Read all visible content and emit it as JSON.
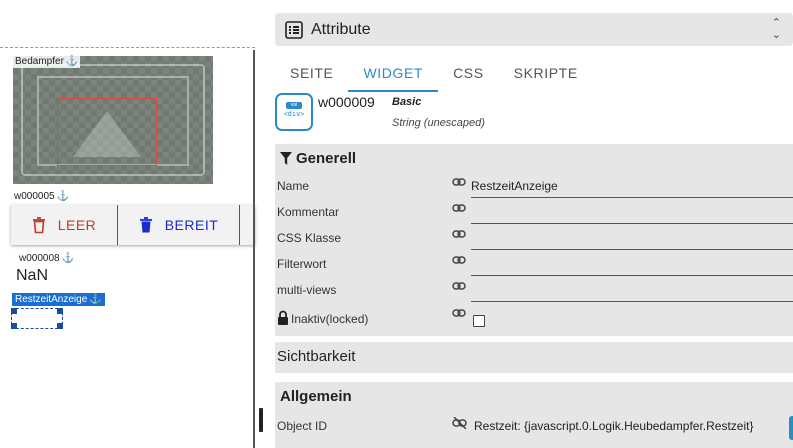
{
  "canvas": {
    "widgets": [
      {
        "id": "w_bedampfer",
        "label": "Bedampfer",
        "anchor": "⚓"
      },
      {
        "id": "w000005",
        "label": "w000005",
        "anchor": "⚓"
      },
      {
        "id": "w000008",
        "label": "w000008",
        "anchor": "⚓"
      },
      {
        "id": "selected",
        "label": "RestzeitAnzeige",
        "anchor": "⚓"
      }
    ],
    "buttons": {
      "leer": "LEER",
      "bereit": "BEREIT"
    },
    "nan_value": "NaN"
  },
  "panel": {
    "title": "Attribute",
    "tabs": [
      "SEITE",
      "WIDGET",
      "CSS",
      "SKRIPTE"
    ],
    "active_tab": "WIDGET",
    "widget": {
      "icon_top": "val",
      "icon_code": "<div>",
      "id": "w000009",
      "set": "Basic",
      "type": "String (unescaped)"
    },
    "groups": {
      "generell": {
        "title": "Generell",
        "rows": [
          {
            "label": "Name",
            "value": "RestzeitAnzeige"
          },
          {
            "label": "Kommentar",
            "value": ""
          },
          {
            "label": "CSS Klasse",
            "value": ""
          },
          {
            "label": "Filterwort",
            "value": ""
          },
          {
            "label": "multi-views",
            "value": ""
          },
          {
            "label": "Inaktiv(locked)",
            "value": ""
          }
        ]
      },
      "sichtbarkeit": {
        "title": "Sichtbarkeit"
      },
      "allgemein": {
        "title": "Allgemein",
        "rows": [
          {
            "label": "Object ID",
            "value": "Restzeit: {javascript.0.Logik.Heubedampfer.Restzeit}"
          }
        ]
      }
    }
  },
  "colors": {
    "accent": "#2b8bc9",
    "leer": "#c0392b",
    "bereit": "#1b2bd0",
    "selection": "#1a6ecf",
    "group_bg": "#e6e6e6"
  }
}
